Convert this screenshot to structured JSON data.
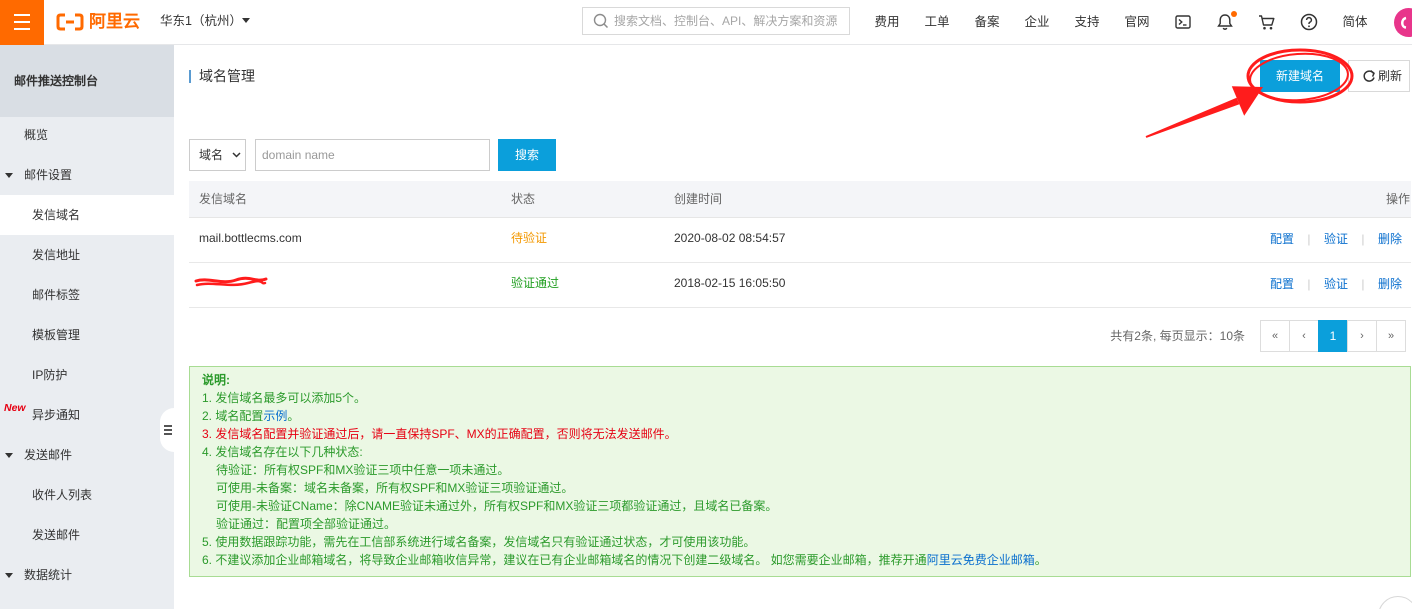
{
  "colors": {
    "brand_orange": "#ff6a00",
    "primary_blue": "#0b9fdb",
    "link_blue": "#0a6fce",
    "pending_orange": "#f39800",
    "success_green": "#1f9f1f",
    "notes_green": "#2b9a2b",
    "notes_bg": "#ebf8e4",
    "notes_border": "#a8dc93",
    "notice_red": "#e60012",
    "annotation_red": "#ff1c1c",
    "avatar_pink": "#e8358b"
  },
  "icons": {
    "menu": "hamburger-icon",
    "logo": "aliyun-logo-icon",
    "region_caret": "caret-down-icon",
    "search": "search-icon",
    "terminal": "terminal-icon",
    "notifications": "bell-icon",
    "cart": "cart-icon",
    "help": "help-icon",
    "refresh": "refresh-icon",
    "select_caret": "chevron-down-icon",
    "collapse": "collapse-sidebar-icon"
  },
  "topbar": {
    "logo_text": "阿里云",
    "region": "华东1（杭州）",
    "search_placeholder": "搜索文档、控制台、API、解决方案和资源",
    "nav": [
      {
        "label": "费用"
      },
      {
        "label": "工单"
      },
      {
        "label": "备案"
      },
      {
        "label": "企业"
      },
      {
        "label": "支持"
      },
      {
        "label": "官网"
      }
    ],
    "notification_unread": true,
    "lang": "简体"
  },
  "sidebar": {
    "title": "邮件推送控制台",
    "items": [
      {
        "label": "概览",
        "level": 0
      },
      {
        "label": "邮件设置",
        "level": 0,
        "expanded": true
      },
      {
        "label": "发信域名",
        "level": 1,
        "selected": true
      },
      {
        "label": "发信地址",
        "level": 1
      },
      {
        "label": "邮件标签",
        "level": 1
      },
      {
        "label": "模板管理",
        "level": 1
      },
      {
        "label": "IP防护",
        "level": 1
      },
      {
        "label": "异步通知",
        "level": 1,
        "badge": "New"
      },
      {
        "label": "发送邮件",
        "level": 0,
        "expanded": true
      },
      {
        "label": "收件人列表",
        "level": 1
      },
      {
        "label": "发送邮件",
        "level": 1
      },
      {
        "label": "数据统计",
        "level": 0,
        "expanded": true
      }
    ]
  },
  "main": {
    "title": "域名管理",
    "actions": {
      "create": "新建域名",
      "refresh": "刷新"
    },
    "search": {
      "field": "域名",
      "placeholder": "domain name",
      "button": "搜索"
    },
    "table": {
      "columns": [
        "发信域名",
        "状态",
        "创建时间",
        "操作"
      ],
      "rows": [
        {
          "domain": "mail.bottlecms.com",
          "status": "待验证",
          "created": "2020-08-02 08:54:57",
          "actions": [
            "配置",
            "验证",
            "删除"
          ]
        },
        {
          "status": "验证通过",
          "created": "2018-02-15 16:05:50",
          "actions": [
            "配置",
            "验证",
            "删除"
          ]
        }
      ],
      "action_separator": "|"
    },
    "pagination": {
      "summary": "共有2条, 每页显示：10条",
      "first": "«",
      "prev": "‹",
      "current": "1",
      "next": "›",
      "last": "»"
    },
    "notes": {
      "heading": "说明:",
      "line1": "1. 发信域名最多可以添加5个。",
      "line2": {
        "before": "2. 域名配置",
        "link": "示例",
        "after": "。"
      },
      "line3": "3. 发信域名配置并验证通过后，请一直保持SPF、MX的正确配置，否则将无法发送邮件。",
      "line4": "4. 发信域名存在以下几种状态:",
      "states": [
        "待验证：所有权SPF和MX验证三项中任意一项未通过。",
        "可使用-未备案：域名未备案，所有权SPF和MX验证三项验证通过。",
        "可使用-未验证CName：除CNAME验证未通过外，所有权SPF和MX验证三项都验证通过，且域名已备案。",
        "验证通过：配置项全部验证通过。"
      ],
      "line5": "5. 使用数据跟踪功能，需先在工信部系统进行域名备案，发信域名只有验证通过状态，才可使用该功能。",
      "line6": {
        "before": "6. 不建议添加企业邮箱域名，将导致企业邮箱收信异常，建议在已有企业邮箱域名的情况下创建二级域名。 如您需要企业邮箱，推荐开通",
        "link": "阿里云免费企业邮箱",
        "after": "。"
      }
    }
  }
}
